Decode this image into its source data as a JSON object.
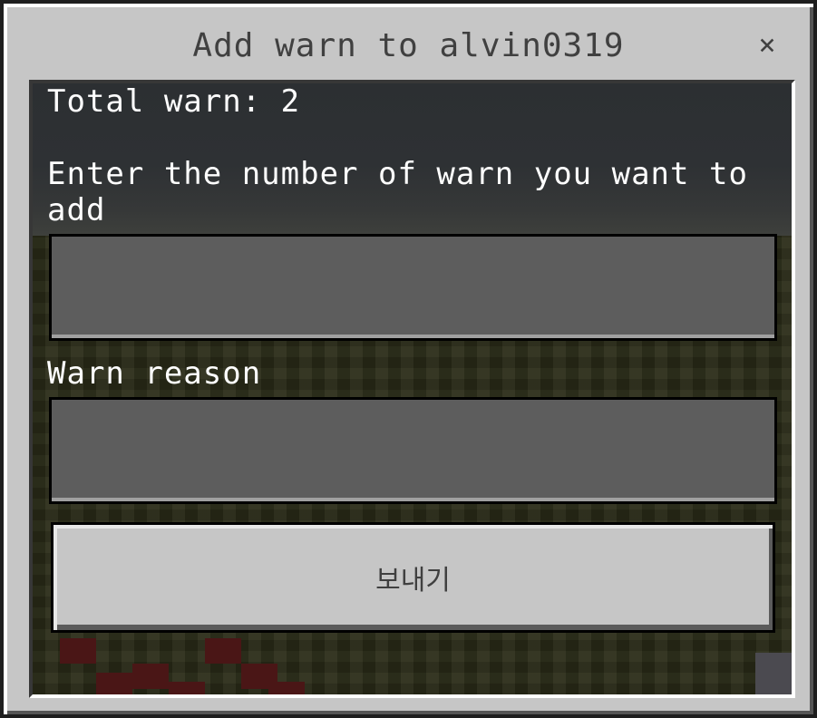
{
  "dialog": {
    "title": "Add warn to alvin0319",
    "close_glyph": "×"
  },
  "form": {
    "total_warn_text": "Total warn: 2",
    "count_prompt": "Enter the number of warn you want to add",
    "count_value": "",
    "reason_label": "Warn reason",
    "reason_value": "",
    "submit_label": "보내기"
  },
  "colors": {
    "dialog_bg": "#c6c6c6",
    "field_bg": "#5d5d5d",
    "text_light": "#ffffff",
    "text_dark": "#404040"
  }
}
